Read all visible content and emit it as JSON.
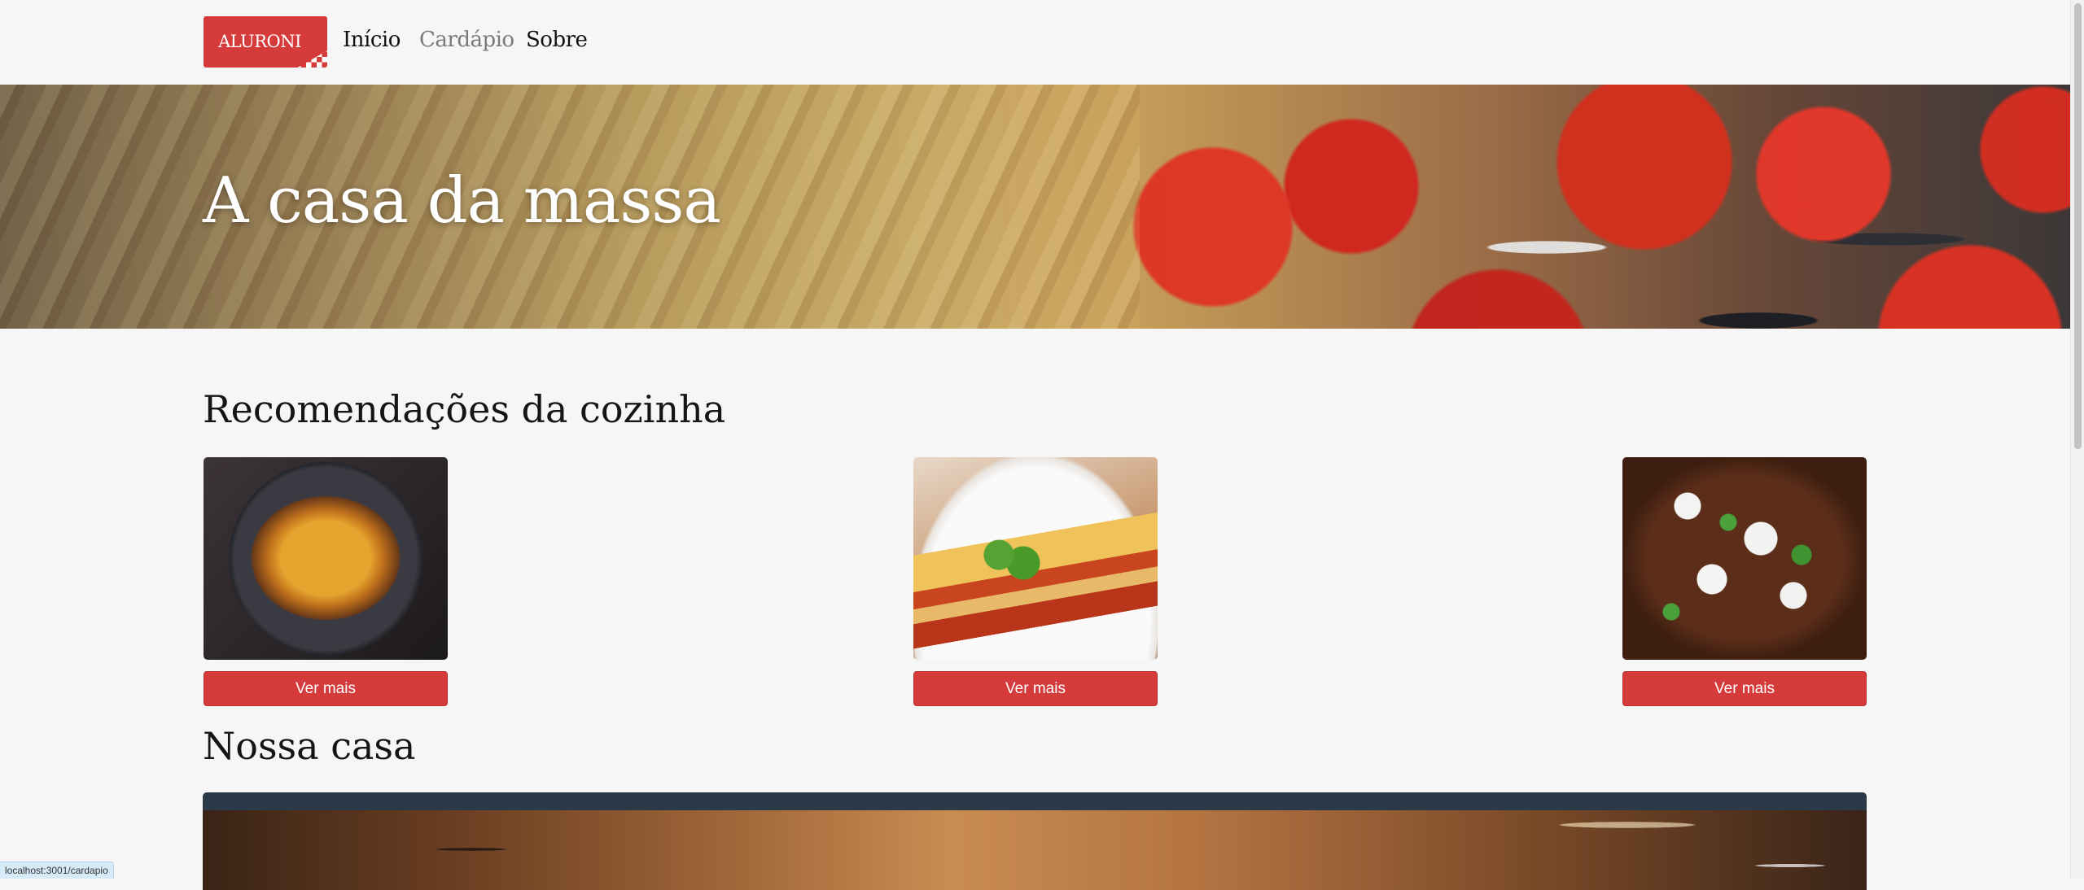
{
  "nav": {
    "logo_text": "ALURONI",
    "links": [
      {
        "label": "Início"
      },
      {
        "label": "Cardápio"
      },
      {
        "label": "Sobre"
      }
    ]
  },
  "hero": {
    "title": "A casa da massa"
  },
  "recommendations": {
    "title": "Recomendações da cozinha",
    "items": [
      {
        "image": "pasta-dish",
        "button_label": "Ver mais"
      },
      {
        "image": "lasagna-dish",
        "button_label": "Ver mais"
      },
      {
        "image": "beef-dish",
        "button_label": "Ver mais"
      }
    ]
  },
  "house": {
    "title": "Nossa casa"
  },
  "status_bar": {
    "link_url": "localhost:3001/cardapio"
  },
  "colors": {
    "accent": "#d63b3b",
    "background": "#f6f6f6",
    "text": "#151515",
    "muted_link": "#7a7a7a"
  }
}
